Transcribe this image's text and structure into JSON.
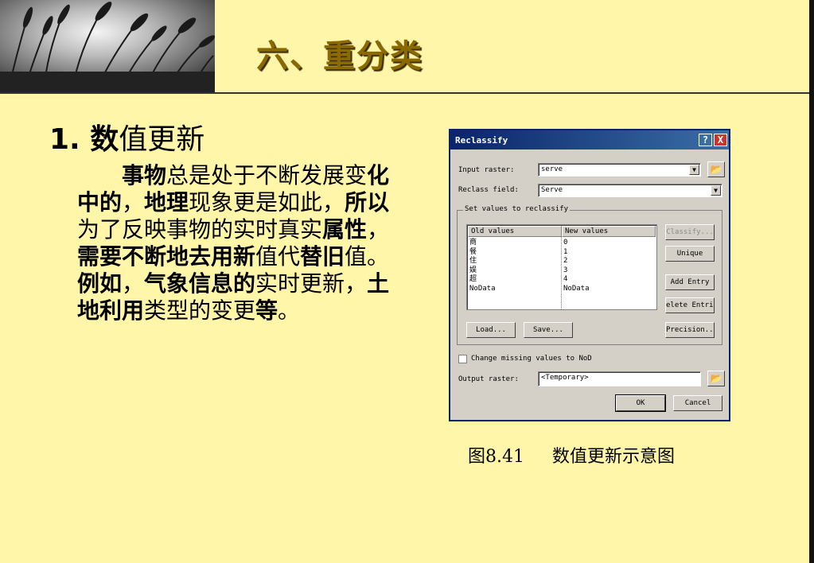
{
  "slide": {
    "title": "六、重分类",
    "sub_heading_bold": "1. 数",
    "sub_heading_rest": "值更新",
    "body_runs": [
      {
        "t": "事物",
        "b": true
      },
      {
        "t": "总是处于不断发展变",
        "b": false
      },
      {
        "t": "化中的",
        "b": true
      },
      {
        "t": "，",
        "b": false
      },
      {
        "t": "地理",
        "b": true
      },
      {
        "t": "现象更是如此，",
        "b": false
      },
      {
        "t": "所以",
        "b": true
      },
      {
        "t": "为了反映事物的实时真实",
        "b": false
      },
      {
        "t": "属性",
        "b": true
      },
      {
        "t": "，",
        "b": false
      },
      {
        "t": "需要不断地去用新",
        "b": true
      },
      {
        "t": "值代",
        "b": false
      },
      {
        "t": "替旧",
        "b": true
      },
      {
        "t": "值。",
        "b": false
      },
      {
        "t": "例如",
        "b": true
      },
      {
        "t": "，",
        "b": false
      },
      {
        "t": "气象信息的",
        "b": true
      },
      {
        "t": "实时更新，",
        "b": false
      },
      {
        "t": "土地利用",
        "b": true
      },
      {
        "t": "类型的变更",
        "b": false
      },
      {
        "t": "等",
        "b": true
      },
      {
        "t": "。",
        "b": false
      }
    ],
    "caption": "图8.41     数值更新示意图"
  },
  "dialog": {
    "title": "Reclassify",
    "help_glyph": "?",
    "close_glyph": "X",
    "input_raster_label": "Input raster:",
    "input_raster_value": "serve",
    "reclass_field_label": "Reclass field:",
    "reclass_field_value": "Serve",
    "group_label": "Set values to reclassify",
    "col_old": "Old values",
    "col_new": "New values",
    "rows": [
      {
        "old": "商",
        "new": "0"
      },
      {
        "old": "餐",
        "new": "1"
      },
      {
        "old": "住",
        "new": "2"
      },
      {
        "old": "娱",
        "new": "3"
      },
      {
        "old": "超",
        "new": "4"
      },
      {
        "old": "NoData",
        "new": "NoData"
      }
    ],
    "classify_label": "Classify...",
    "unique_label": "Unique",
    "add_entry_label": "Add Entry",
    "delete_entries_label": "elete Entrie",
    "load_label": "Load...",
    "save_label": "Save...",
    "precision_label": "Precision...",
    "missing_label": "Change missing values to NoD",
    "output_raster_label": "Output raster:",
    "output_raster_value": "<Temporary>",
    "ok_label": "OK",
    "cancel_label": "Cancel",
    "dropdown_glyph": "▼",
    "folder_glyph": "📂"
  }
}
